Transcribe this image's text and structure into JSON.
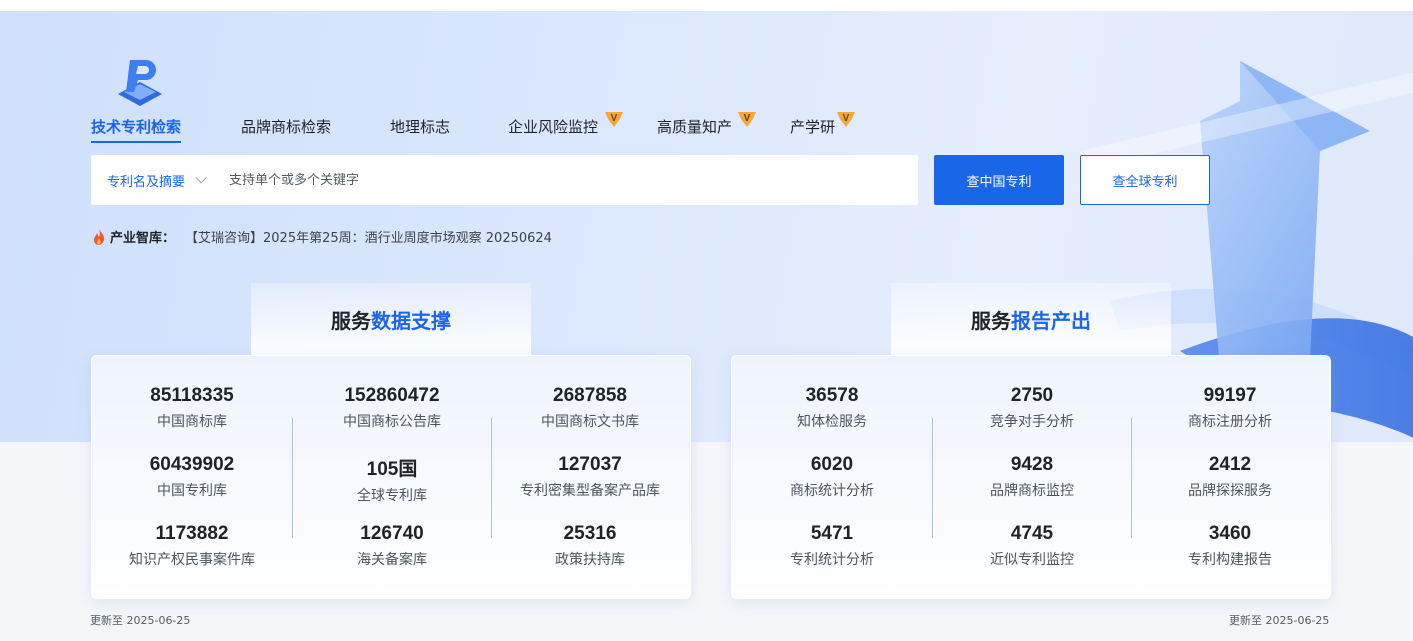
{
  "tabs": [
    {
      "label": "技术专利检索",
      "active": true,
      "vip": false
    },
    {
      "label": "品牌商标检索",
      "active": false,
      "vip": false
    },
    {
      "label": "地理标志",
      "active": false,
      "vip": false
    },
    {
      "label": "企业风险监控",
      "active": false,
      "vip": true
    },
    {
      "label": "高质量知产",
      "active": false,
      "vip": true
    },
    {
      "label": "产学研",
      "active": false,
      "vip": true
    }
  ],
  "vip_badge": "V",
  "search": {
    "scope": "专利名及摘要",
    "placeholder": "支持单个或多个关键字",
    "btn_china": "查中国专利",
    "btn_global": "查全球专利"
  },
  "news": {
    "label": "产业智库：",
    "text": "【艾瑞咨询】2025年第25周：酒行业周度市场观察 20250624"
  },
  "left_panel": {
    "title_dark": "服务",
    "title_blue": "数据支撑",
    "stats": [
      {
        "value": "85118335",
        "label": "中国商标库"
      },
      {
        "value": "152860472",
        "label": "中国商标公告库"
      },
      {
        "value": "2687858",
        "label": "中国商标文书库"
      },
      {
        "value": "60439902",
        "label": "中国专利库"
      },
      {
        "value": "105国",
        "label": "全球专利库"
      },
      {
        "value": "127037",
        "label": "专利密集型备案产品库"
      },
      {
        "value": "1173882",
        "label": "知识产权民事案件库"
      },
      {
        "value": "126740",
        "label": "海关备案库"
      },
      {
        "value": "25316",
        "label": "政策扶持库"
      }
    ],
    "updated": "更新至 2025-06-25"
  },
  "right_panel": {
    "title_dark": "服务",
    "title_blue": "报告产出",
    "stats": [
      {
        "value": "36578",
        "label": "知体检服务"
      },
      {
        "value": "2750",
        "label": "竞争对手分析"
      },
      {
        "value": "99197",
        "label": "商标注册分析"
      },
      {
        "value": "6020",
        "label": "商标统计分析"
      },
      {
        "value": "9428",
        "label": "品牌商标监控"
      },
      {
        "value": "2412",
        "label": "品牌探探服务"
      },
      {
        "value": "5471",
        "label": "专利统计分析"
      },
      {
        "value": "4745",
        "label": "近似专利监控"
      },
      {
        "value": "3460",
        "label": "专利构建报告"
      }
    ],
    "updated": "更新至 2025-06-25"
  },
  "colors": {
    "accent": "#1a66e8",
    "vip": "#f2a93b"
  }
}
